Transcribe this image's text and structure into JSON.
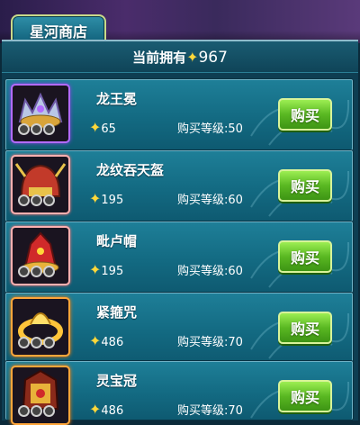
{
  "shop": {
    "tab_title": "星河商店",
    "balance_label": "当前拥有",
    "balance_value": "967"
  },
  "items": [
    {
      "name": "龙王冕",
      "price": "65",
      "level_label": "购买等级:50",
      "buy_label": "购买"
    },
    {
      "name": "龙纹吞天盔",
      "price": "195",
      "level_label": "购买等级:60",
      "buy_label": "购买"
    },
    {
      "name": "毗卢帽",
      "price": "195",
      "level_label": "购买等级:60",
      "buy_label": "购买"
    },
    {
      "name": "紧箍咒",
      "price": "486",
      "level_label": "购买等级:70",
      "buy_label": "购买"
    },
    {
      "name": "灵宝冠",
      "price": "486",
      "level_label": "购买等级:70",
      "buy_label": "购买"
    }
  ],
  "icons": [
    "star-icon",
    "dragon-crown-icon",
    "dragon-helmet-icon",
    "red-hat-icon",
    "golden-headband-icon",
    "treasure-crown-icon"
  ],
  "colors": {
    "star": "#ffd83a",
    "buy_button": "#5ab822",
    "panel": "#0e3e52"
  }
}
